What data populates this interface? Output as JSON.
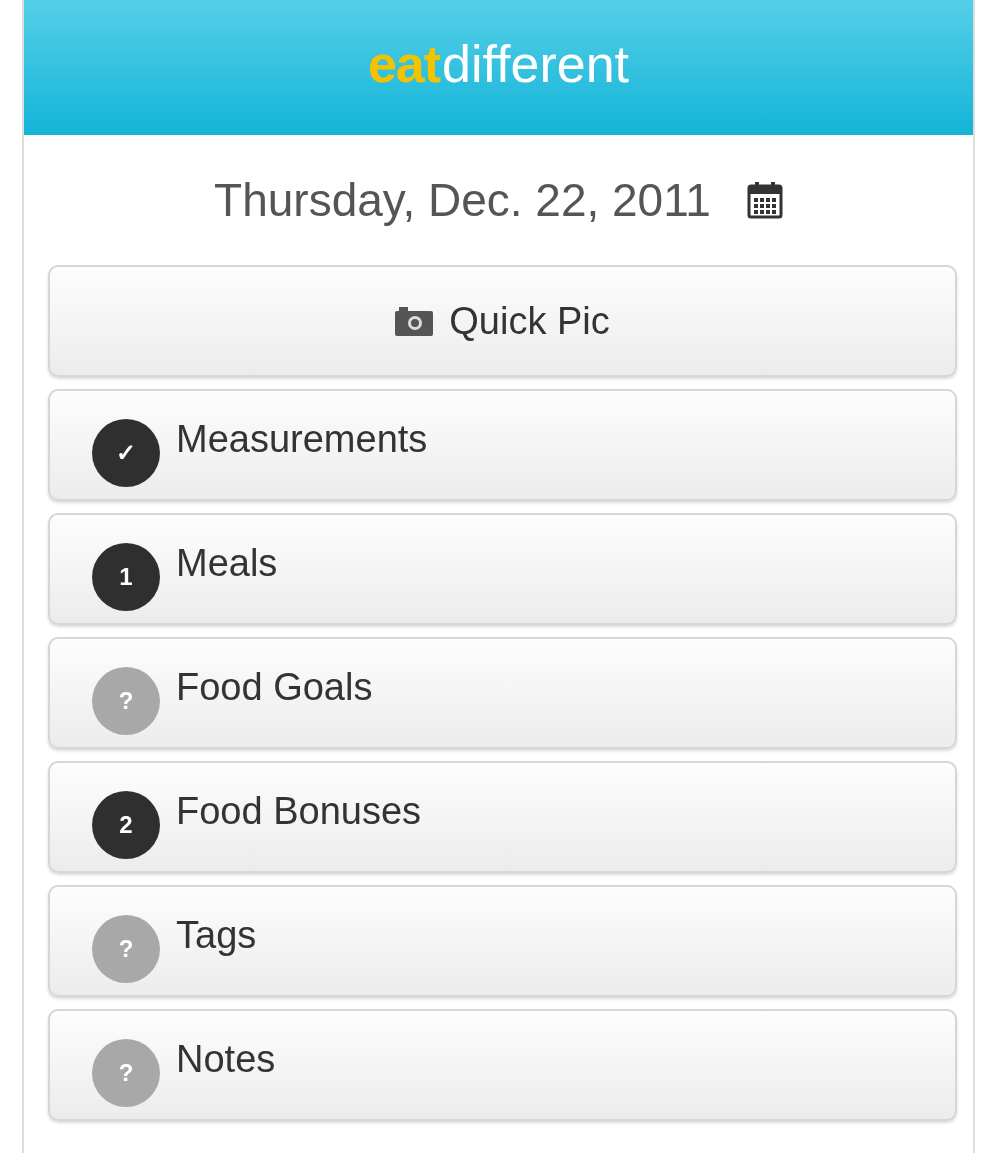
{
  "header": {
    "logo_bold": "eat",
    "logo_light": "different"
  },
  "date": {
    "label": "Thursday, Dec. 22, 2011"
  },
  "quick_button": {
    "label": "Quick Pic"
  },
  "items": [
    {
      "label": "Measurements",
      "badge": "✓",
      "kind": "done"
    },
    {
      "label": "Meals",
      "badge": "1",
      "kind": "done"
    },
    {
      "label": "Food Goals",
      "badge": "?",
      "kind": "pending"
    },
    {
      "label": "Food Bonuses",
      "badge": "2",
      "kind": "done"
    },
    {
      "label": "Tags",
      "badge": "?",
      "kind": "pending"
    },
    {
      "label": "Notes",
      "badge": "?",
      "kind": "pending"
    }
  ]
}
